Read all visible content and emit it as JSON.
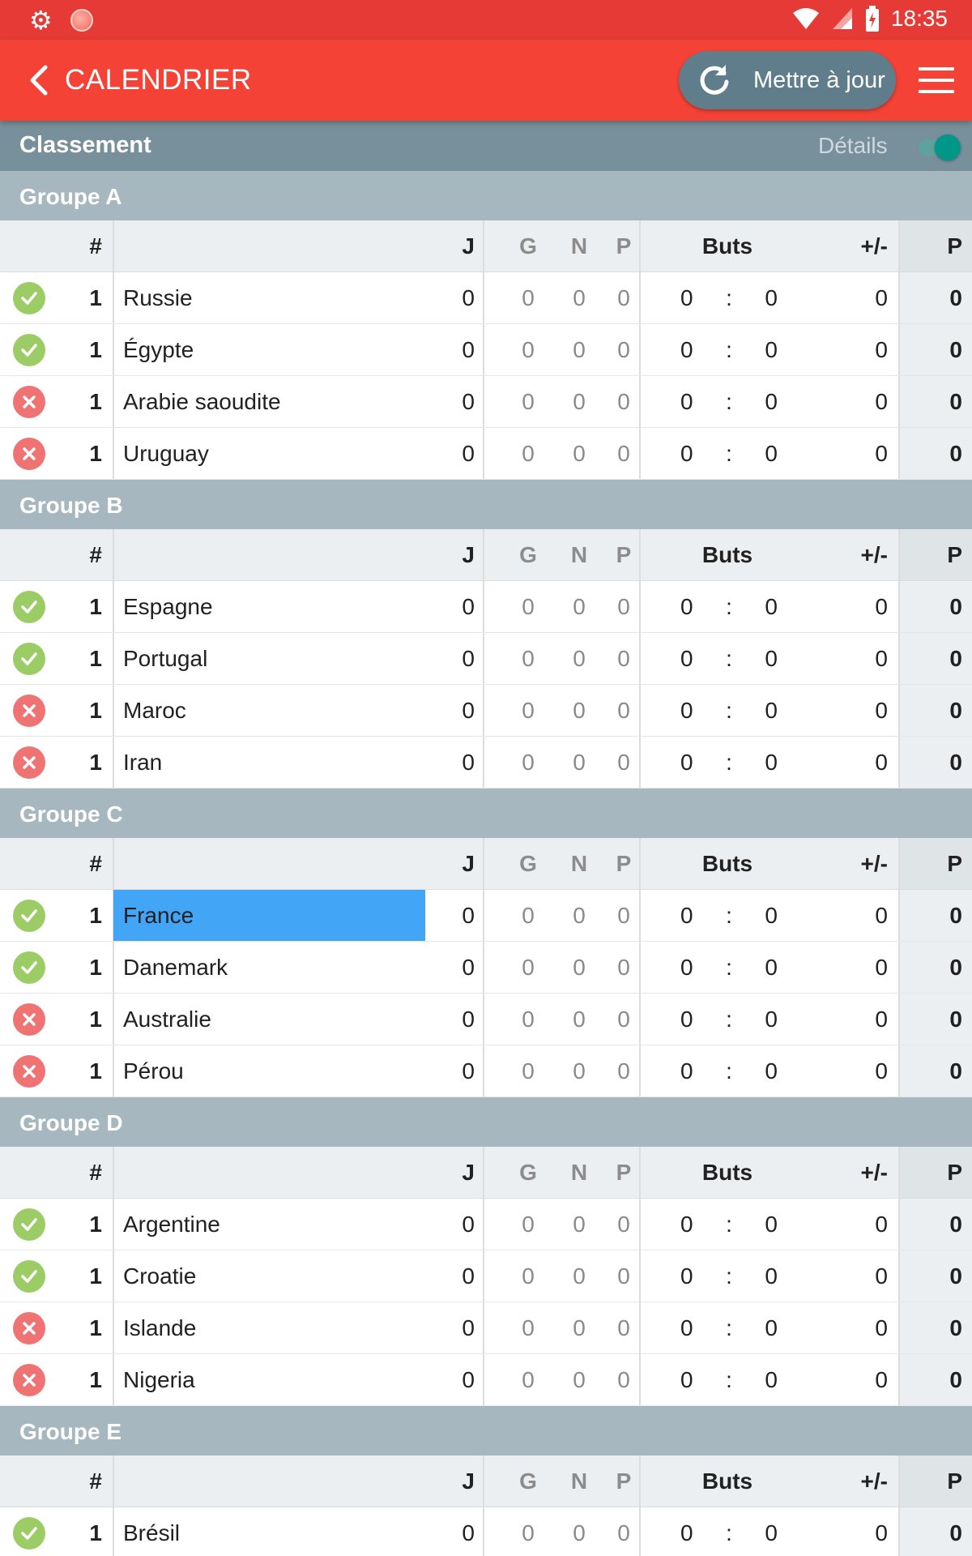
{
  "status_bar": {
    "time": "18:35",
    "icons": [
      "gear-icon",
      "ball-icon",
      "wifi-icon",
      "signal-icon",
      "battery-icon"
    ]
  },
  "app_bar": {
    "title": "CALENDRIER",
    "update_label": "Mettre à jour"
  },
  "standings_bar": {
    "title": "Classement",
    "details_label": "Détails",
    "details_on": true
  },
  "columns": {
    "rank": "#",
    "j": "J",
    "g": "G",
    "n": "N",
    "p": "P",
    "buts": "Buts",
    "diff": "+/-",
    "pts": "P"
  },
  "colors": {
    "primary": "#f44336",
    "status_bar": "#e53a36",
    "update_button": "#607d8b",
    "group_header": "#a6b7bf",
    "toggle": "#009688",
    "qualified": "#9ccc65",
    "eliminated": "#ef7373",
    "selected_team": "#42a5f5"
  },
  "groups": [
    {
      "name": "Groupe A",
      "teams": [
        {
          "status": "ok",
          "rank": "1",
          "team": "Russie",
          "j": "0",
          "g": "0",
          "n": "0",
          "p": "0",
          "gf": "0",
          "sep": ":",
          "ga": "0",
          "diff": "0",
          "pts": "0"
        },
        {
          "status": "ok",
          "rank": "1",
          "team": "Égypte",
          "j": "0",
          "g": "0",
          "n": "0",
          "p": "0",
          "gf": "0",
          "sep": ":",
          "ga": "0",
          "diff": "0",
          "pts": "0"
        },
        {
          "status": "ko",
          "rank": "1",
          "team": "Arabie saoudite",
          "j": "0",
          "g": "0",
          "n": "0",
          "p": "0",
          "gf": "0",
          "sep": ":",
          "ga": "0",
          "diff": "0",
          "pts": "0"
        },
        {
          "status": "ko",
          "rank": "1",
          "team": "Uruguay",
          "j": "0",
          "g": "0",
          "n": "0",
          "p": "0",
          "gf": "0",
          "sep": ":",
          "ga": "0",
          "diff": "0",
          "pts": "0"
        }
      ]
    },
    {
      "name": "Groupe B",
      "teams": [
        {
          "status": "ok",
          "rank": "1",
          "team": "Espagne",
          "j": "0",
          "g": "0",
          "n": "0",
          "p": "0",
          "gf": "0",
          "sep": ":",
          "ga": "0",
          "diff": "0",
          "pts": "0"
        },
        {
          "status": "ok",
          "rank": "1",
          "team": "Portugal",
          "j": "0",
          "g": "0",
          "n": "0",
          "p": "0",
          "gf": "0",
          "sep": ":",
          "ga": "0",
          "diff": "0",
          "pts": "0"
        },
        {
          "status": "ko",
          "rank": "1",
          "team": "Maroc",
          "j": "0",
          "g": "0",
          "n": "0",
          "p": "0",
          "gf": "0",
          "sep": ":",
          "ga": "0",
          "diff": "0",
          "pts": "0"
        },
        {
          "status": "ko",
          "rank": "1",
          "team": "Iran",
          "j": "0",
          "g": "0",
          "n": "0",
          "p": "0",
          "gf": "0",
          "sep": ":",
          "ga": "0",
          "diff": "0",
          "pts": "0"
        }
      ]
    },
    {
      "name": "Groupe C",
      "teams": [
        {
          "status": "ok",
          "rank": "1",
          "team": "France",
          "selected": true,
          "j": "0",
          "g": "0",
          "n": "0",
          "p": "0",
          "gf": "0",
          "sep": ":",
          "ga": "0",
          "diff": "0",
          "pts": "0"
        },
        {
          "status": "ok",
          "rank": "1",
          "team": "Danemark",
          "j": "0",
          "g": "0",
          "n": "0",
          "p": "0",
          "gf": "0",
          "sep": ":",
          "ga": "0",
          "diff": "0",
          "pts": "0"
        },
        {
          "status": "ko",
          "rank": "1",
          "team": "Australie",
          "j": "0",
          "g": "0",
          "n": "0",
          "p": "0",
          "gf": "0",
          "sep": ":",
          "ga": "0",
          "diff": "0",
          "pts": "0"
        },
        {
          "status": "ko",
          "rank": "1",
          "team": "Pérou",
          "j": "0",
          "g": "0",
          "n": "0",
          "p": "0",
          "gf": "0",
          "sep": ":",
          "ga": "0",
          "diff": "0",
          "pts": "0"
        }
      ]
    },
    {
      "name": "Groupe D",
      "teams": [
        {
          "status": "ok",
          "rank": "1",
          "team": "Argentine",
          "j": "0",
          "g": "0",
          "n": "0",
          "p": "0",
          "gf": "0",
          "sep": ":",
          "ga": "0",
          "diff": "0",
          "pts": "0"
        },
        {
          "status": "ok",
          "rank": "1",
          "team": "Croatie",
          "j": "0",
          "g": "0",
          "n": "0",
          "p": "0",
          "gf": "0",
          "sep": ":",
          "ga": "0",
          "diff": "0",
          "pts": "0"
        },
        {
          "status": "ko",
          "rank": "1",
          "team": "Islande",
          "j": "0",
          "g": "0",
          "n": "0",
          "p": "0",
          "gf": "0",
          "sep": ":",
          "ga": "0",
          "diff": "0",
          "pts": "0"
        },
        {
          "status": "ko",
          "rank": "1",
          "team": "Nigeria",
          "j": "0",
          "g": "0",
          "n": "0",
          "p": "0",
          "gf": "0",
          "sep": ":",
          "ga": "0",
          "diff": "0",
          "pts": "0"
        }
      ]
    },
    {
      "name": "Groupe E",
      "teams": [
        {
          "status": "ok",
          "rank": "1",
          "team": "Brésil",
          "j": "0",
          "g": "0",
          "n": "0",
          "p": "0",
          "gf": "0",
          "sep": ":",
          "ga": "0",
          "diff": "0",
          "pts": "0"
        }
      ]
    }
  ]
}
